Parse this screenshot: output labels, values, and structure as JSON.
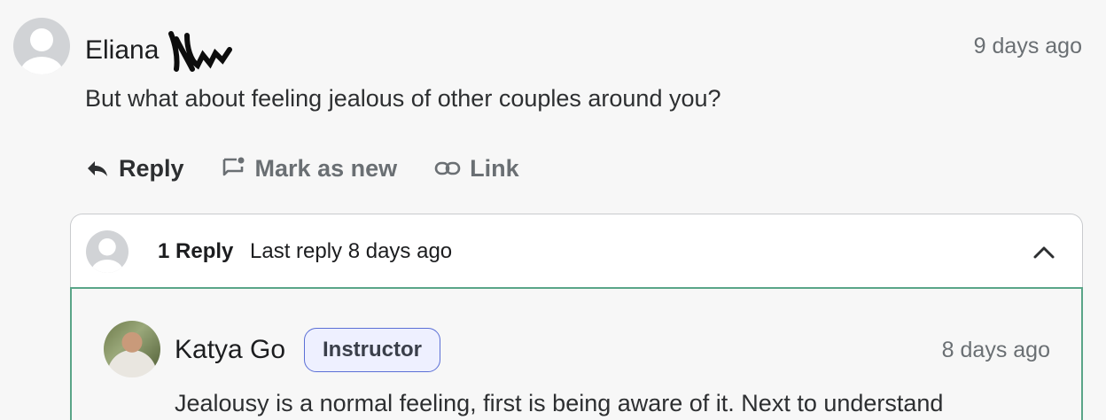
{
  "comment": {
    "author": "Eliana",
    "time": "9 days ago",
    "body": "But what about feeling jealous of other couples around you?",
    "actions": {
      "reply": "Reply",
      "mark_new": "Mark as new",
      "link": "Link"
    }
  },
  "thread": {
    "count": "1 Reply",
    "last_reply": "Last reply 8 days ago"
  },
  "reply": {
    "author": "Katya Go",
    "badge": "Instructor",
    "time": "8 days ago",
    "body": "Jealousy is a normal feeling, first is being aware of it. Next to understand"
  },
  "colors": {
    "accent_border": "#5aa588",
    "badge_border": "#5b6fd6"
  }
}
